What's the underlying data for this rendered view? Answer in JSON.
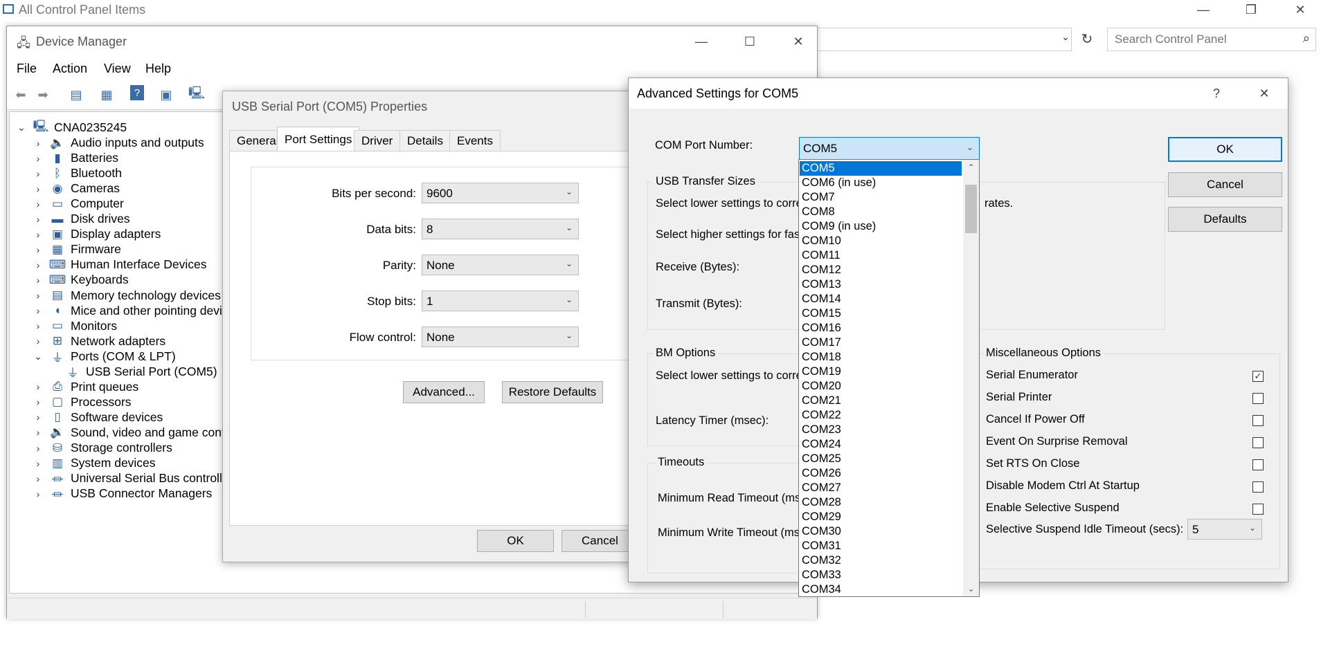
{
  "control_panel": {
    "title": "All Control Panel Items",
    "search_placeholder": "Search Control Panel"
  },
  "device_manager": {
    "title": "Device Manager",
    "menu": [
      "File",
      "Action",
      "View",
      "Help"
    ],
    "tree": {
      "root": "CNA0235245",
      "items": [
        {
          "label": "Audio inputs and outputs",
          "icon": "speaker-icon",
          "expanded": false
        },
        {
          "label": "Batteries",
          "icon": "battery-icon",
          "expanded": false
        },
        {
          "label": "Bluetooth",
          "icon": "bluetooth-icon",
          "expanded": false
        },
        {
          "label": "Cameras",
          "icon": "camera-icon",
          "expanded": false
        },
        {
          "label": "Computer",
          "icon": "monitor-icon",
          "expanded": false
        },
        {
          "label": "Disk drives",
          "icon": "disk-icon",
          "expanded": false
        },
        {
          "label": "Display adapters",
          "icon": "display-adapter-icon",
          "expanded": false
        },
        {
          "label": "Firmware",
          "icon": "chip-icon",
          "expanded": false
        },
        {
          "label": "Human Interface Devices",
          "icon": "hid-icon",
          "expanded": false
        },
        {
          "label": "Keyboards",
          "icon": "keyboard-icon",
          "expanded": false
        },
        {
          "label": "Memory technology devices",
          "icon": "memory-icon",
          "expanded": false
        },
        {
          "label": "Mice and other pointing devices",
          "icon": "mouse-icon",
          "expanded": false
        },
        {
          "label": "Monitors",
          "icon": "monitor-icon",
          "expanded": false
        },
        {
          "label": "Network adapters",
          "icon": "network-icon",
          "expanded": false
        },
        {
          "label": "Ports (COM & LPT)",
          "icon": "port-icon",
          "expanded": true
        },
        {
          "label": "USB Serial Port (COM5)",
          "icon": "port-icon",
          "child": true
        },
        {
          "label": "Print queues",
          "icon": "printer-icon",
          "expanded": false
        },
        {
          "label": "Processors",
          "icon": "processor-icon",
          "expanded": false
        },
        {
          "label": "Software devices",
          "icon": "software-device-icon",
          "expanded": false
        },
        {
          "label": "Sound, video and game controllers",
          "icon": "sound-icon",
          "expanded": false
        },
        {
          "label": "Storage controllers",
          "icon": "storage-icon",
          "expanded": false
        },
        {
          "label": "System devices",
          "icon": "system-icon",
          "expanded": false
        },
        {
          "label": "Universal Serial Bus controllers",
          "icon": "usb-icon",
          "expanded": false
        },
        {
          "label": "USB Connector Managers",
          "icon": "usb-icon",
          "expanded": false
        }
      ]
    }
  },
  "properties": {
    "title": "USB Serial Port (COM5) Properties",
    "tabs": [
      "General",
      "Port Settings",
      "Driver",
      "Details",
      "Events"
    ],
    "active_tab": "Port Settings",
    "fields": [
      {
        "label": "Bits per second:",
        "value": "9600"
      },
      {
        "label": "Data bits:",
        "value": "8"
      },
      {
        "label": "Parity:",
        "value": "None"
      },
      {
        "label": "Stop bits:",
        "value": "1"
      },
      {
        "label": "Flow control:",
        "value": "None"
      }
    ],
    "advanced_label": "Advanced...",
    "restore_label": "Restore Defaults",
    "ok_label": "OK",
    "cancel_label": "Cancel"
  },
  "advanced": {
    "title": "Advanced Settings for COM5",
    "help_glyph": "?",
    "com_port_label": "COM Port Number:",
    "com_port_value": "COM5",
    "com_options": [
      "COM5",
      "COM6 (in use)",
      "COM7",
      "COM8",
      "COM9 (in use)",
      "COM10",
      "COM11",
      "COM12",
      "COM13",
      "COM14",
      "COM15",
      "COM16",
      "COM17",
      "COM18",
      "COM19",
      "COM20",
      "COM21",
      "COM22",
      "COM23",
      "COM24",
      "COM25",
      "COM26",
      "COM27",
      "COM28",
      "COM29",
      "COM30",
      "COM31",
      "COM32",
      "COM33",
      "COM34"
    ],
    "usb_transfer": {
      "title": "USB Transfer Sizes",
      "lower_text": "Select lower settings to corre",
      "lower_tail": "rates.",
      "higher_text": "Select higher settings for faste",
      "receive_label": "Receive (Bytes):",
      "transmit_label": "Transmit (Bytes):"
    },
    "bm_options": {
      "title": "BM Options",
      "lower_text": "Select lower settings to corre",
      "latency_label": "Latency Timer (msec):"
    },
    "timeouts": {
      "title": "Timeouts",
      "read_label": "Minimum Read Timeout (mse",
      "write_label": "Minimum Write Timeout (mse"
    },
    "misc": {
      "title": "Miscellaneous Options",
      "options": [
        {
          "label": "Serial Enumerator",
          "checked": true
        },
        {
          "label": "Serial Printer",
          "checked": false
        },
        {
          "label": "Cancel If Power Off",
          "checked": false
        },
        {
          "label": "Event On Surprise Removal",
          "checked": false
        },
        {
          "label": "Set RTS On Close",
          "checked": false
        },
        {
          "label": "Disable Modem Ctrl At Startup",
          "checked": false
        },
        {
          "label": "Enable Selective Suspend",
          "checked": false
        }
      ],
      "suspend_label": "Selective Suspend Idle Timeout (secs):",
      "suspend_value": "5"
    },
    "ok_label": "OK",
    "cancel_label": "Cancel",
    "defaults_label": "Defaults"
  },
  "colors": {
    "accent": "#0078d7",
    "selection_bg": "#cce4f7"
  }
}
